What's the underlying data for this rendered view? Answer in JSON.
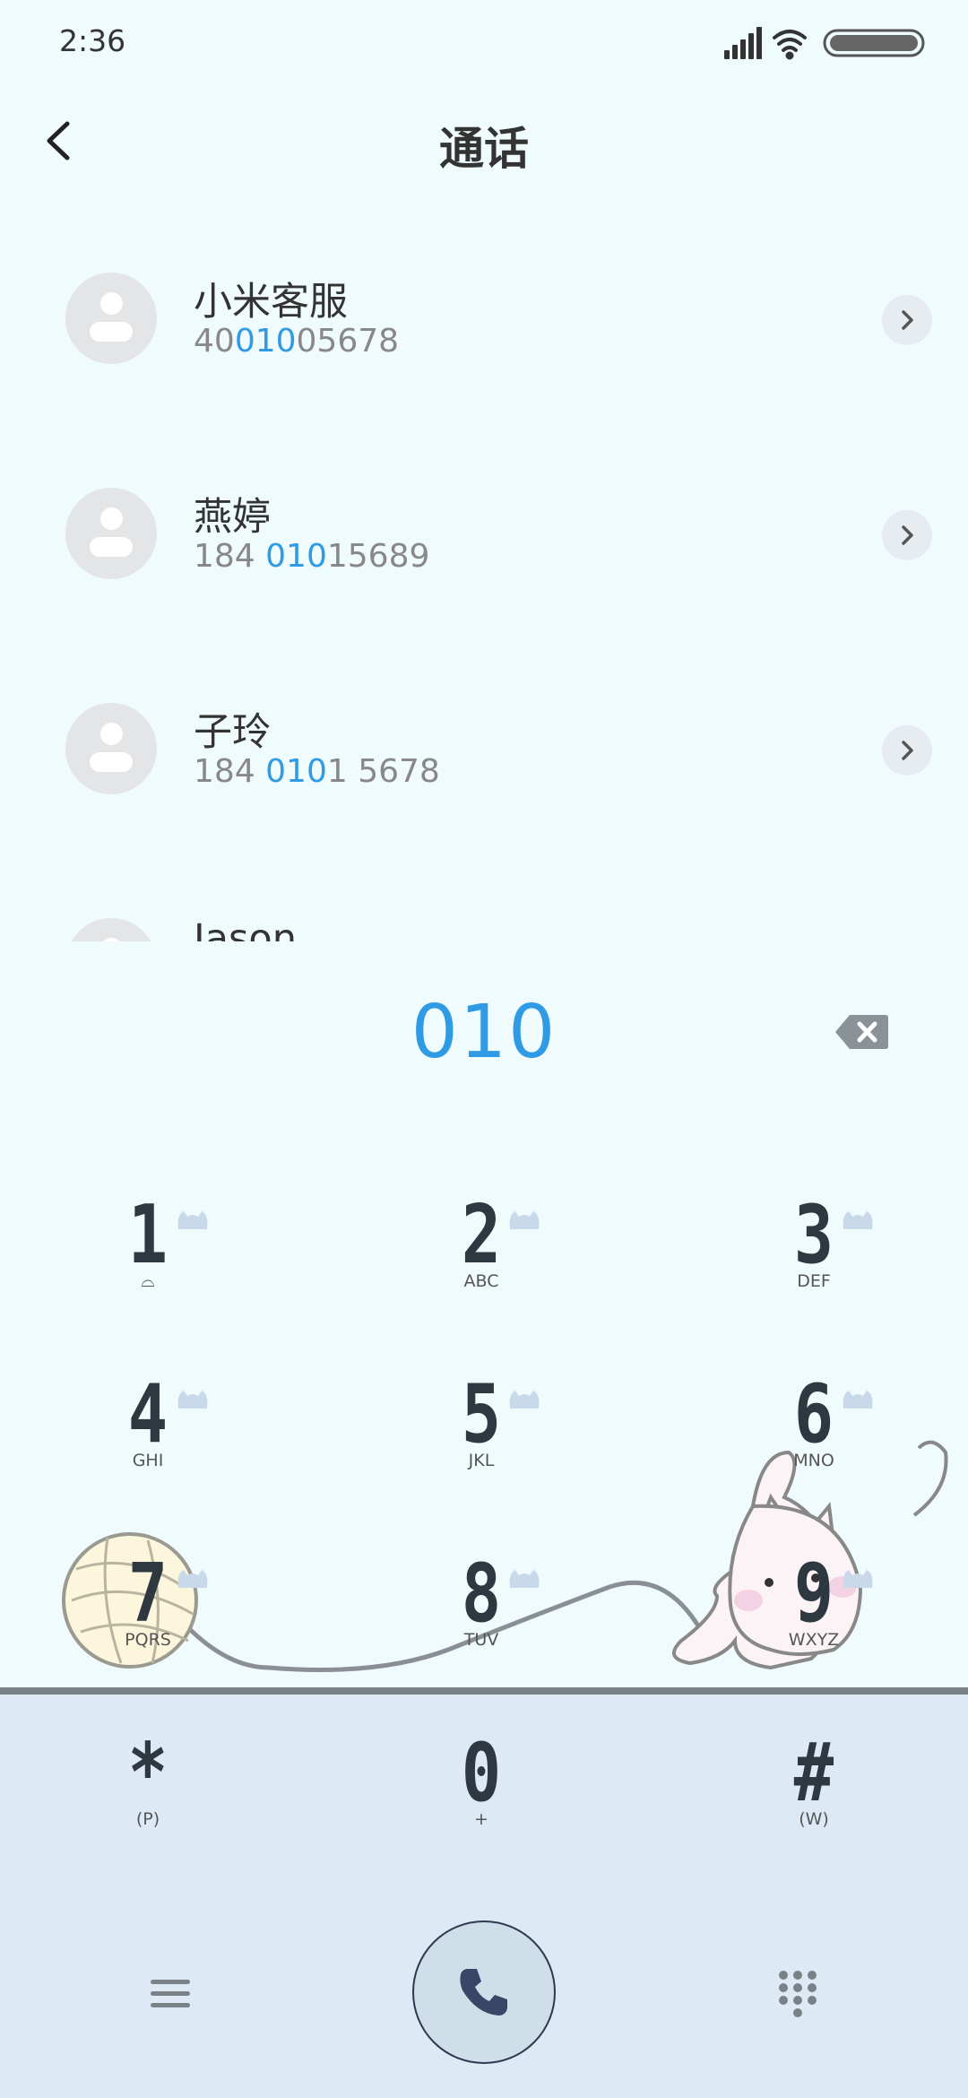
{
  "status_bar": {
    "time": "2:36"
  },
  "header": {
    "title": "通话"
  },
  "contacts": [
    {
      "name": "小米客服",
      "number_parts": [
        "40",
        "010",
        "05678"
      ]
    },
    {
      "name": "燕婷",
      "number_parts": [
        "184 ",
        "010",
        "15689"
      ]
    },
    {
      "name": "子玲",
      "number_parts": [
        "184 ",
        "010",
        "1 5678"
      ]
    },
    {
      "name": "Jason",
      "number_parts": [
        "",
        "",
        ""
      ]
    }
  ],
  "dial": {
    "number": "010"
  },
  "keypad": [
    {
      "digit": "1",
      "letters": "ᅟ"
    },
    {
      "digit": "2",
      "letters": "ABC"
    },
    {
      "digit": "3",
      "letters": "DEF"
    },
    {
      "digit": "4",
      "letters": "GHI"
    },
    {
      "digit": "5",
      "letters": "JKL"
    },
    {
      "digit": "6",
      "letters": "MNO"
    },
    {
      "digit": "7",
      "letters": "PQRS"
    },
    {
      "digit": "8",
      "letters": "TUV"
    },
    {
      "digit": "9",
      "letters": "WXYZ"
    },
    {
      "digit": "*",
      "letters": "(P)"
    },
    {
      "digit": "0",
      "letters": "+"
    },
    {
      "digit": "#",
      "letters": "(W)"
    }
  ],
  "colors": {
    "accent": "#2f9be5",
    "background": "#f0fbfd",
    "floor": "#dde9f5"
  },
  "icons": {
    "back": "chevron-left-icon",
    "row_action": "chevron-right-icon",
    "backspace": "backspace-icon",
    "menu": "menu-icon",
    "call": "phone-icon",
    "dialpad": "dialpad-icon"
  }
}
